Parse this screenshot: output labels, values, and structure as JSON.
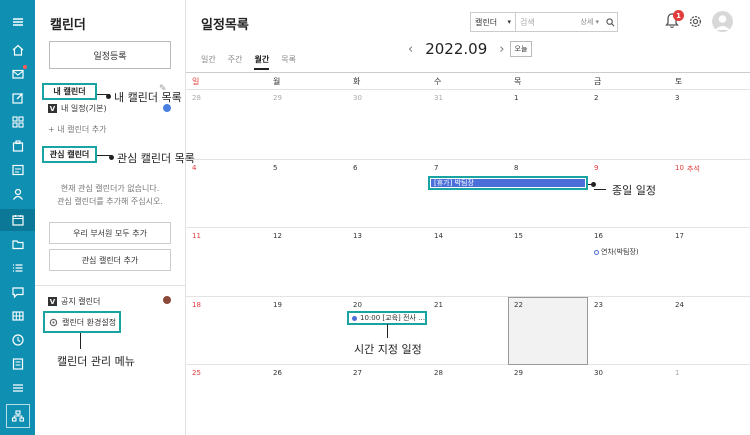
{
  "rail": {
    "icons": [
      "menu-icon",
      "home-icon",
      "mail-icon",
      "edit-icon",
      "apps-icon",
      "clipboard-icon",
      "card-icon",
      "user-icon",
      "calendar-icon",
      "folder-icon",
      "list-icon",
      "chat-icon",
      "grid-icon",
      "clock-icon",
      "note-icon",
      "stack-icon",
      "org-icon"
    ]
  },
  "sidebar": {
    "title": "캘린더",
    "register_button": "일정등록",
    "my_calendar_label": "내 캘린더",
    "my_calendar_callout": "내 캘린더 목록",
    "my_schedule": "내 일정(기본)",
    "add_my_calendar": "+ 내 캘린더 추가",
    "interest_calendar_label": "관심 캘린더",
    "interest_calendar_callout": "관심 캘린더 목록",
    "empty_message": "현재 관심 캘린더가 없습니다.\n관심 캘린더를 추가해 주십시오.",
    "add_dept_all": "우리 부서원 모두 추가",
    "add_interest": "관심 캘린더 추가",
    "public_calendar": "공지 캘린더",
    "settings": "캘린더 환경설정",
    "manage_label": "캘린더 관리 메뉴",
    "my_dot_color": "#4a7fe0",
    "public_dot_color": "#8b4a3a"
  },
  "header": {
    "title": "일정목록",
    "search_select": "캘린더",
    "search_placeholder": "검색",
    "search_detail": "상세 ▾",
    "notification_count": "1"
  },
  "tabs": [
    "일간",
    "주간",
    "월간",
    "목록"
  ],
  "active_tab": "월간",
  "month_label": "2022.09",
  "today_button": "오늘",
  "weekdays": [
    "일",
    "월",
    "화",
    "수",
    "목",
    "금",
    "토"
  ],
  "weeks": [
    [
      "28",
      "29",
      "30",
      "31",
      "1",
      "2",
      "3"
    ],
    [
      "4",
      "5",
      "6",
      "7",
      "8",
      "9",
      "10"
    ],
    [
      "11",
      "12",
      "13",
      "14",
      "15",
      "16",
      "17"
    ],
    [
      "18",
      "19",
      "20",
      "21",
      "22",
      "23",
      "24"
    ],
    [
      "25",
      "26",
      "27",
      "28",
      "29",
      "30",
      "1"
    ]
  ],
  "holiday_label": "추석",
  "events": {
    "allday_text": "[휴가] 박팀장",
    "allday_callout": "종일 일정",
    "timed_text": "10:00 [교육] 전사 …",
    "timed_callout": "시간 지정 일정",
    "leave_text": "연차(박팀장)"
  },
  "colors": {
    "rail": "#0f8fb1",
    "accent": "#1aa3a3",
    "event_blue": "#4a6fd8",
    "sunday_red": "#e23b3b"
  }
}
